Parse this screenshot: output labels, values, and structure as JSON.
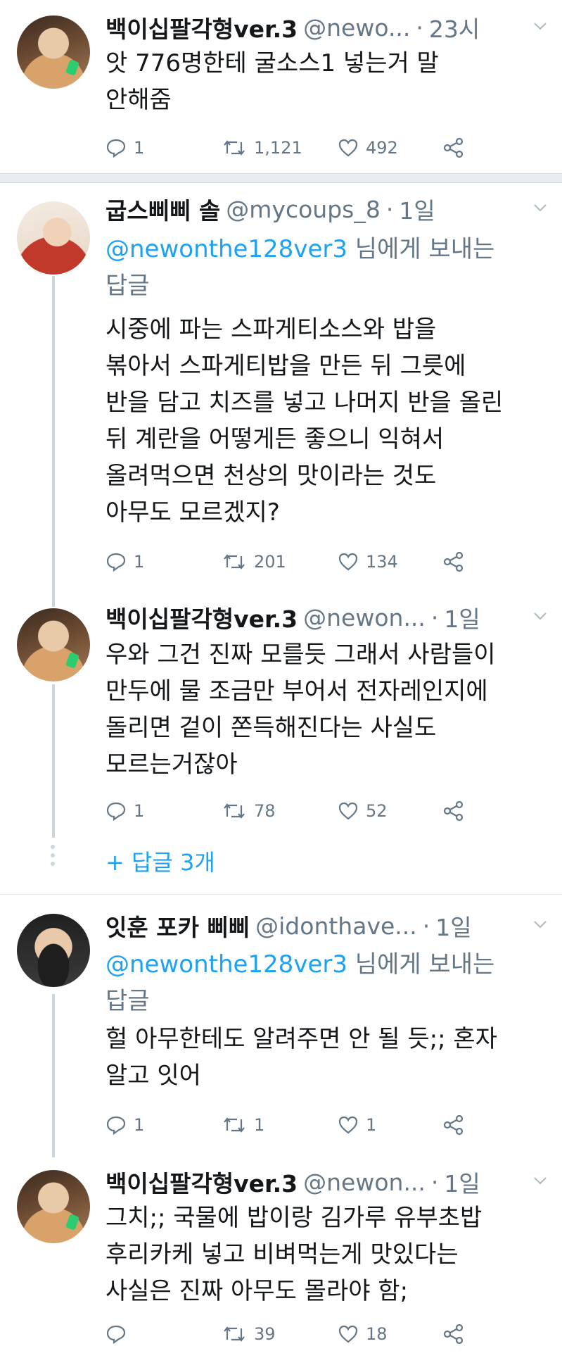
{
  "tweets": [
    {
      "name": "백이십팔각형ver.3",
      "handle": "@newo...",
      "time": "23시",
      "reply_to": null,
      "text": "앗 776명한테 굴소스1 넣는거 말\n안해줌",
      "replies": "1",
      "retweets": "1,121",
      "likes": "492"
    },
    {
      "name": "굽스삐삐 솔",
      "handle": "@mycoups_8",
      "time": "1일",
      "reply_to": {
        "mention": "@newonthe128ver3",
        "suffix": " 님에게 보내는",
        "line2": "답글"
      },
      "text": "시중에 파는 스파게티소스와 밥을\n볶아서 스파게티밥을 만든 뒤 그릇에\n반을 담고 치즈를 넣고 나머지 반을 올린\n뒤 계란을 어떻게든 좋으니 익혀서\n올려먹으면 천상의 맛이라는 것도\n아무도 모르겠지?",
      "replies": "1",
      "retweets": "201",
      "likes": "134"
    },
    {
      "name": "백이십팔각형ver.3",
      "handle": "@newon...",
      "time": "1일",
      "reply_to": null,
      "text": "우와 그건 진짜 모를듯 그래서 사람들이\n만두에 물 조금만 부어서 전자레인지에\n돌리면 겉이 쫀득해진다는 사실도\n모르는거잖아",
      "replies": "1",
      "retweets": "78",
      "likes": "52"
    },
    {
      "name": "잇훈 포카 삐삐",
      "handle": "@idonthave...",
      "time": "1일",
      "reply_to": {
        "mention": "@newonthe128ver3",
        "suffix": " 님에게 보내는",
        "line2": "답글"
      },
      "text": "헐 아무한테도 알려주면 안 될 듯;; 혼자\n알고 잇어",
      "replies": "1",
      "retweets": "1",
      "likes": "1"
    },
    {
      "name": "백이십팔각형ver.3",
      "handle": "@newon...",
      "time": "1일",
      "reply_to": null,
      "text": "그치;; 국물에 밥이랑 김가루 유부초밥\n후리카케 넣고 비벼먹는게 맛있다는\n사실은 진짜 아무도 몰라야 함;",
      "replies": "",
      "retweets": "39",
      "likes": "18"
    }
  ],
  "more_replies": "+ 답글 3개",
  "separator_dot": "·",
  "icons": {
    "reply": "reply-icon",
    "retweet": "retweet-icon",
    "like": "heart-icon",
    "share": "share-icon",
    "caret": "chevron-down-icon"
  },
  "colors": {
    "accent": "#1da1f2",
    "secondary_text": "#657786",
    "separator": "#e6ecf0"
  }
}
